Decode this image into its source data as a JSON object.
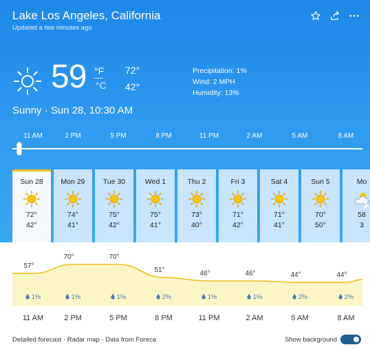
{
  "location": "Lake Los Angeles, California",
  "updated": "Updated a few minutes ago",
  "current": {
    "temp": "59",
    "unit_f": "°F",
    "unit_c": "°C",
    "high": "72°",
    "low": "42°",
    "precipitation": "Precipitation: 1%",
    "wind": "Wind: 2 MPH",
    "humidity": "Humidity: 13%",
    "condition": "Sunny · Sun 28, 10:30 AM"
  },
  "timeline": {
    "labels": [
      "11 AM",
      "2 PM",
      "5 PM",
      "8 PM",
      "11 PM",
      "2 AM",
      "5 AM",
      "8 AM"
    ],
    "position": 0.02
  },
  "days": [
    {
      "name": "Sun 28",
      "hi": "72°",
      "lo": "42°",
      "icon": "sun-icon"
    },
    {
      "name": "Mon 29",
      "hi": "74°",
      "lo": "41°",
      "icon": "sun-icon"
    },
    {
      "name": "Tue 30",
      "hi": "75°",
      "lo": "42°",
      "icon": "sun-icon"
    },
    {
      "name": "Wed 1",
      "hi": "75°",
      "lo": "41°",
      "icon": "sun-icon"
    },
    {
      "name": "Thu 2",
      "hi": "73°",
      "lo": "40°",
      "icon": "sun-icon"
    },
    {
      "name": "Fri 3",
      "hi": "71°",
      "lo": "42°",
      "icon": "sun-icon"
    },
    {
      "name": "Sat 4",
      "hi": "71°",
      "lo": "41°",
      "icon": "sun-icon"
    },
    {
      "name": "Sun 5",
      "hi": "70°",
      "lo": "50°",
      "icon": "sun-icon"
    },
    {
      "name": "Mo",
      "hi": "58",
      "lo": "3",
      "icon": "partly-cloudy-icon"
    }
  ],
  "hourly": {
    "temps": [
      {
        "label": "57°",
        "temp": 57
      },
      {
        "label": "70°",
        "temp": 70
      },
      {
        "label": "70°",
        "temp": 70
      },
      {
        "label": "51°",
        "temp": 51
      },
      {
        "label": "46°",
        "temp": 46
      },
      {
        "label": "46°",
        "temp": 46
      },
      {
        "label": "44°",
        "temp": 44
      },
      {
        "label": "44°",
        "temp": 44
      }
    ],
    "precip": [
      "1%",
      "1%",
      "1%",
      "2%",
      "1%",
      "1%",
      "2%",
      "2%"
    ],
    "hours": [
      "11 AM",
      "2 PM",
      "5 PM",
      "8 PM",
      "11 PM",
      "2 AM",
      "5 AM",
      "8 AM"
    ]
  },
  "footer": {
    "links": "Detailed forecast · Radar map · Data from Foreca",
    "show_background": "Show background"
  },
  "colors": {
    "accent_yellow": "#f1bd1b",
    "sky_blue": "#2f9bf0",
    "graph_fill": "#fbf5c7"
  }
}
